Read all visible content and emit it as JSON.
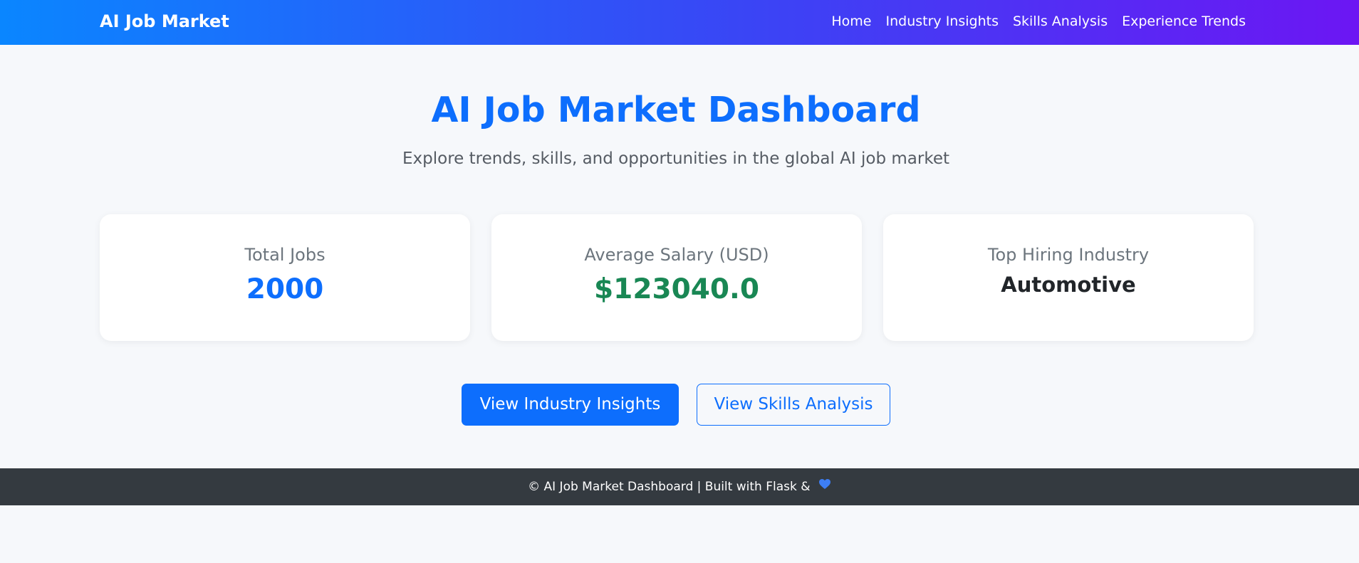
{
  "navbar": {
    "brand": "AI Job Market",
    "links": [
      "Home",
      "Industry Insights",
      "Skills Analysis",
      "Experience Trends"
    ]
  },
  "hero": {
    "title": "AI Job Market Dashboard",
    "subtitle": "Explore trends, skills, and opportunities in the global AI job market"
  },
  "stats": [
    {
      "label": "Total Jobs",
      "value": "2000",
      "color": "#0d6efd"
    },
    {
      "label": "Average Salary (USD)",
      "value": "$123040.0",
      "color": "#198754"
    },
    {
      "label": "Top Hiring Industry",
      "value": "Automotive",
      "color": "#212529"
    }
  ],
  "actions": {
    "primary": "View Industry Insights",
    "secondary": "View Skills Analysis"
  },
  "footer": {
    "text": "© AI Job Market Dashboard | Built with Flask &",
    "icon": "blue-heart-icon"
  },
  "colors": {
    "accent": "#0d6efd",
    "gradient_start": "#0a86ff",
    "gradient_end": "#6c16f3",
    "footer_bg": "#343a40"
  }
}
